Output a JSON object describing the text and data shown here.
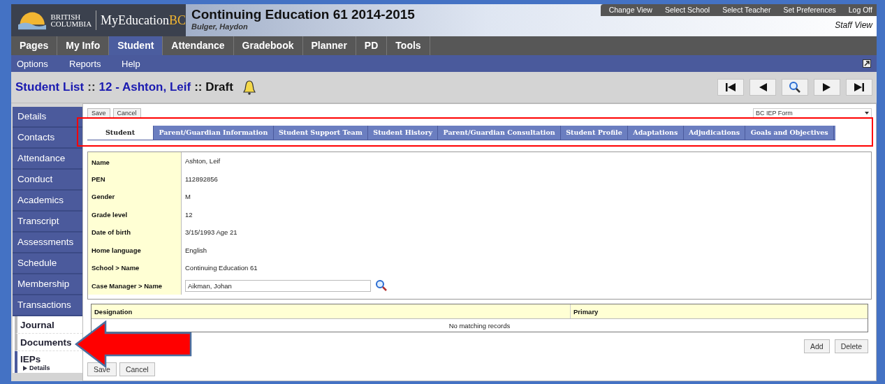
{
  "header": {
    "logo_line_1": "BRITISH",
    "logo_line_2": "COLUMBIA",
    "logo_name": "MyEducation",
    "logo_suffix": "BC",
    "title": "Continuing Education 61 2014-2015",
    "user": "Bulger, Haydon",
    "view": "Staff View",
    "links": [
      "Change View",
      "Select School",
      "Select Teacher",
      "Set Preferences",
      "Log Off"
    ]
  },
  "nav_tabs": [
    {
      "label": "Pages",
      "selected": false
    },
    {
      "label": "My Info",
      "selected": false
    },
    {
      "label": "Student",
      "selected": true
    },
    {
      "label": "Attendance",
      "selected": false
    },
    {
      "label": "Gradebook",
      "selected": false
    },
    {
      "label": "Planner",
      "selected": false
    },
    {
      "label": "PD",
      "selected": false
    },
    {
      "label": "Tools",
      "selected": false
    }
  ],
  "sub_nav": [
    "Options",
    "Reports",
    "Help"
  ],
  "breadcrumb": [
    {
      "text": "Student List",
      "kind": "link"
    },
    {
      "text": "::",
      "kind": "sep"
    },
    {
      "text": "12 - Ashton, Leif",
      "kind": "link"
    },
    {
      "text": ":: Draft",
      "kind": "plain"
    }
  ],
  "sidebar": [
    {
      "label": "Details",
      "kind": "tab"
    },
    {
      "label": "Contacts",
      "kind": "tab"
    },
    {
      "label": "Attendance",
      "kind": "tab"
    },
    {
      "label": "Conduct",
      "kind": "tab"
    },
    {
      "label": "Academics",
      "kind": "tab"
    },
    {
      "label": "Transcript",
      "kind": "tab"
    },
    {
      "label": "Assessments",
      "kind": "tab"
    },
    {
      "label": "Schedule",
      "kind": "tab"
    },
    {
      "label": "Membership",
      "kind": "tab"
    },
    {
      "label": "Transactions",
      "kind": "tab"
    },
    {
      "label": "Journal",
      "kind": "link"
    },
    {
      "label": "Documents",
      "kind": "link"
    },
    {
      "label": "IEPs",
      "kind": "link",
      "children": [
        {
          "label": "Details"
        }
      ]
    }
  ],
  "top_buttons": [
    "Save",
    "Cancel"
  ],
  "form_select": {
    "value": "BC IEP Form"
  },
  "form_tabs": [
    {
      "label": "Student",
      "selected": true
    },
    {
      "label": "Parent/Guardian Information",
      "selected": false
    },
    {
      "label": "Student Support Team",
      "selected": false
    },
    {
      "label": "Student History",
      "selected": false
    },
    {
      "label": "Parent/Guardian Consultation",
      "selected": false
    },
    {
      "label": "Student Profile",
      "selected": false
    },
    {
      "label": "Adaptations",
      "selected": false
    },
    {
      "label": "Adjudications",
      "selected": false
    },
    {
      "label": "Goals and Objectives",
      "selected": false
    }
  ],
  "fields": [
    {
      "label": "Name",
      "value": "Ashton, Leif",
      "kind": "text"
    },
    {
      "label": "PEN",
      "value": "112892856",
      "kind": "text"
    },
    {
      "label": "Gender",
      "value": "M",
      "kind": "text"
    },
    {
      "label": "Grade level",
      "value": "12",
      "kind": "text"
    },
    {
      "label": "Date of birth",
      "value": "3/15/1993  Age  21",
      "kind": "text"
    },
    {
      "label": "Home language",
      "value": "English",
      "kind": "text"
    },
    {
      "label": "School > Name",
      "value": "Continuing Education 61",
      "kind": "text"
    },
    {
      "label": "Case Manager > Name",
      "value": "Aikman, Johan",
      "kind": "input"
    }
  ],
  "designation_table": {
    "columns": [
      "Designation",
      "Primary"
    ],
    "empty_text": "No matching records"
  },
  "table_buttons": [
    "Add",
    "Delete"
  ],
  "bottom_buttons": [
    "Save",
    "Cancel"
  ]
}
